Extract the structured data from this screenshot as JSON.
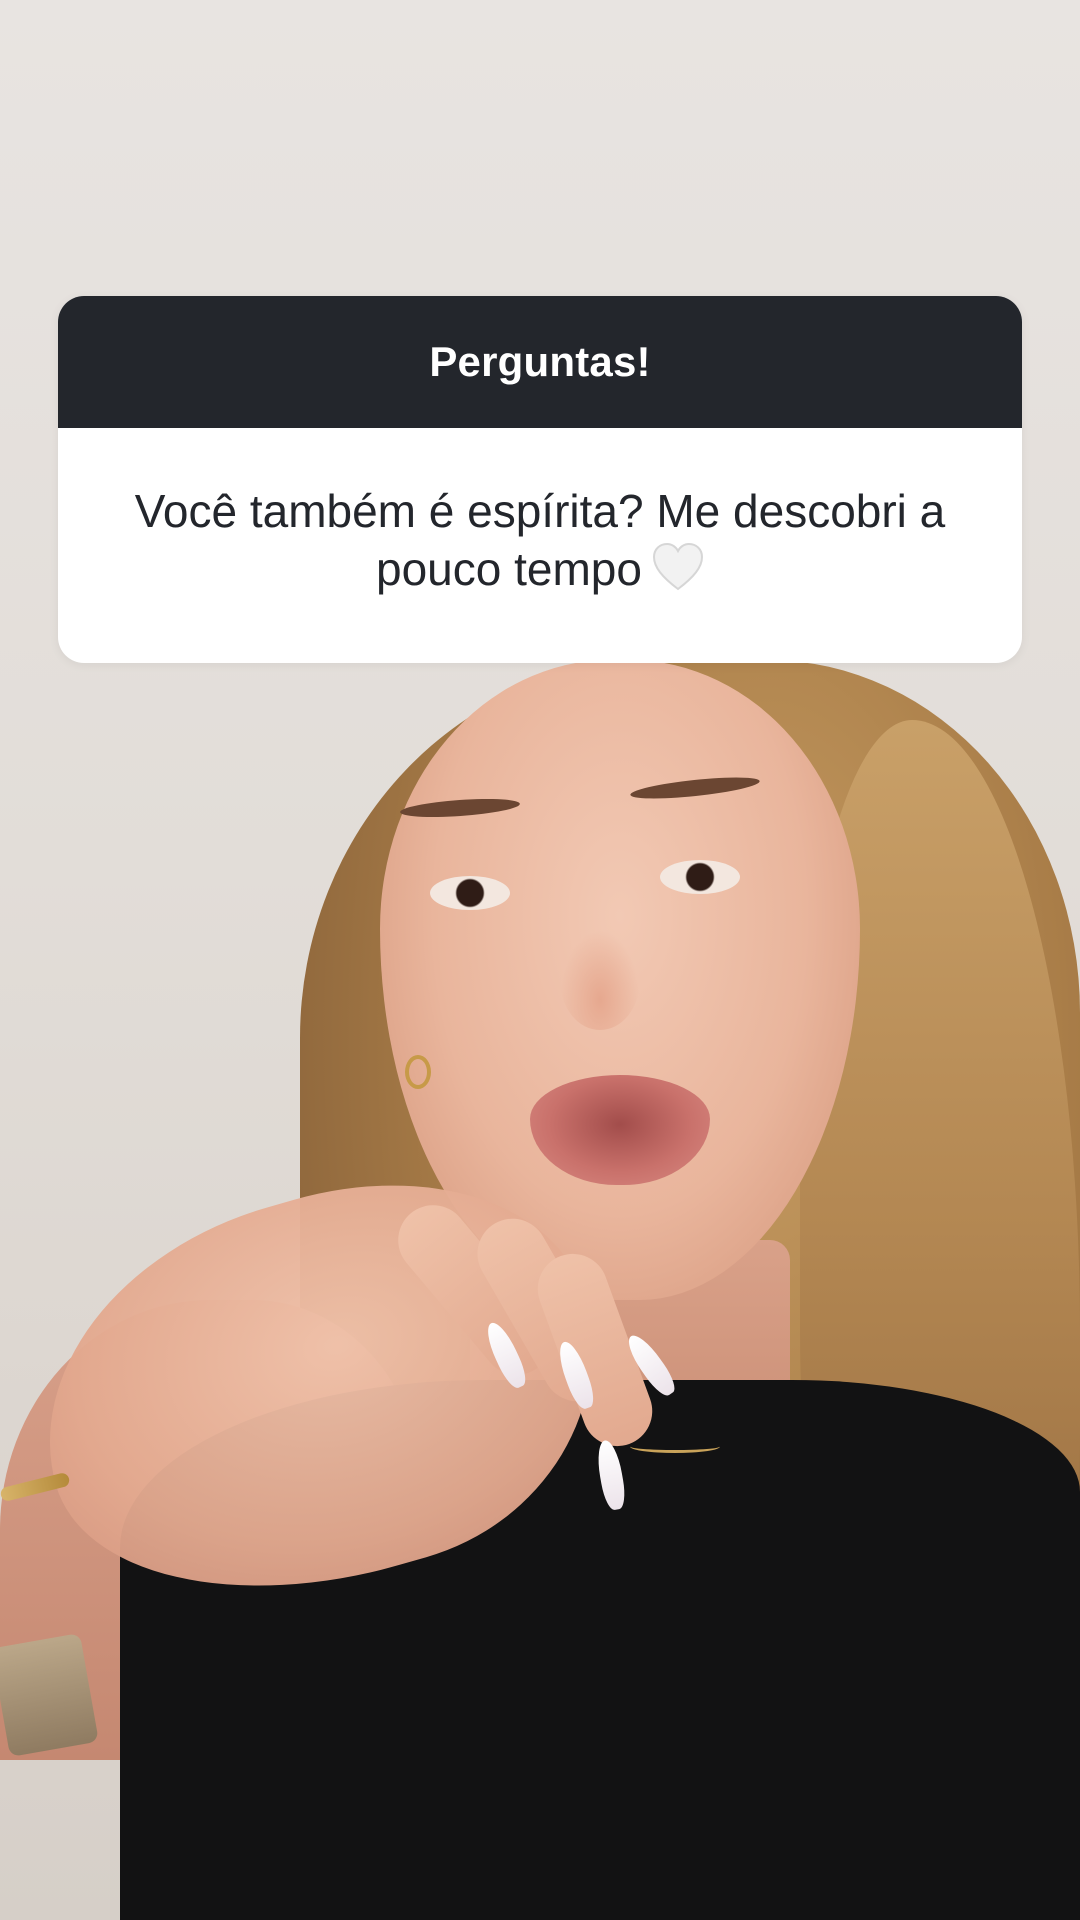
{
  "story": {
    "question_sticker": {
      "title": "Perguntas!",
      "question": "Você também é espírita? Me descobri a pouco tempo",
      "emoji_icon": "white-heart-icon"
    }
  },
  "colors": {
    "sticker_header_bg": "#23262c",
    "sticker_body_bg": "#ffffff",
    "sticker_text": "#23262c"
  }
}
